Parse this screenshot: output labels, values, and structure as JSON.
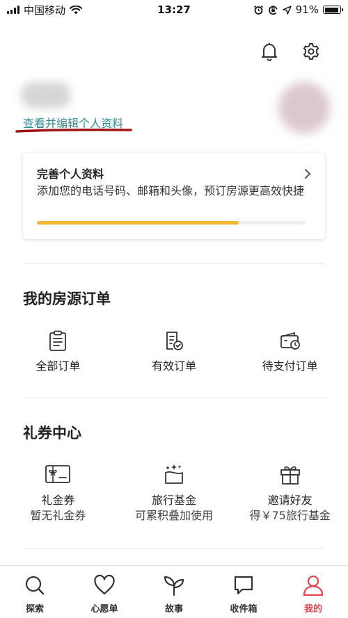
{
  "status_bar": {
    "carrier": "中国移动",
    "time": "13:27",
    "battery": "91%",
    "battery_level": 0.91
  },
  "profile": {
    "edit_link": "查看并编辑个人资料"
  },
  "completion_card": {
    "title": "完善个人资料",
    "description": "添加您的电话号码、邮箱和头像，预订房源更高效快捷",
    "progress": 0.75,
    "accent_color": "#f0b730"
  },
  "orders": {
    "title": "我的房源订单",
    "items": [
      {
        "label": "全部订单",
        "icon": "clipboard-icon"
      },
      {
        "label": "有效订单",
        "icon": "valid-order-icon"
      },
      {
        "label": "待支付订单",
        "icon": "wallet-clock-icon"
      }
    ]
  },
  "coupons": {
    "title": "礼券中心",
    "items": [
      {
        "label": "礼金券",
        "sub": "暂无礼金券",
        "icon": "gift-card-icon"
      },
      {
        "label": "旅行基金",
        "sub": "可累积叠加使用",
        "icon": "travel-fund-icon"
      },
      {
        "label": "邀请好友",
        "sub": "得￥75旅行基金",
        "icon": "gift-box-icon"
      }
    ]
  },
  "bottom_nav": {
    "active_color": "#e2434f",
    "items": [
      {
        "label": "探索",
        "icon": "search-icon"
      },
      {
        "label": "心愿单",
        "icon": "heart-icon"
      },
      {
        "label": "故事",
        "icon": "sprout-icon"
      },
      {
        "label": "收件箱",
        "icon": "chat-bubble-icon"
      },
      {
        "label": "我的",
        "icon": "person-icon",
        "active": true
      }
    ]
  }
}
